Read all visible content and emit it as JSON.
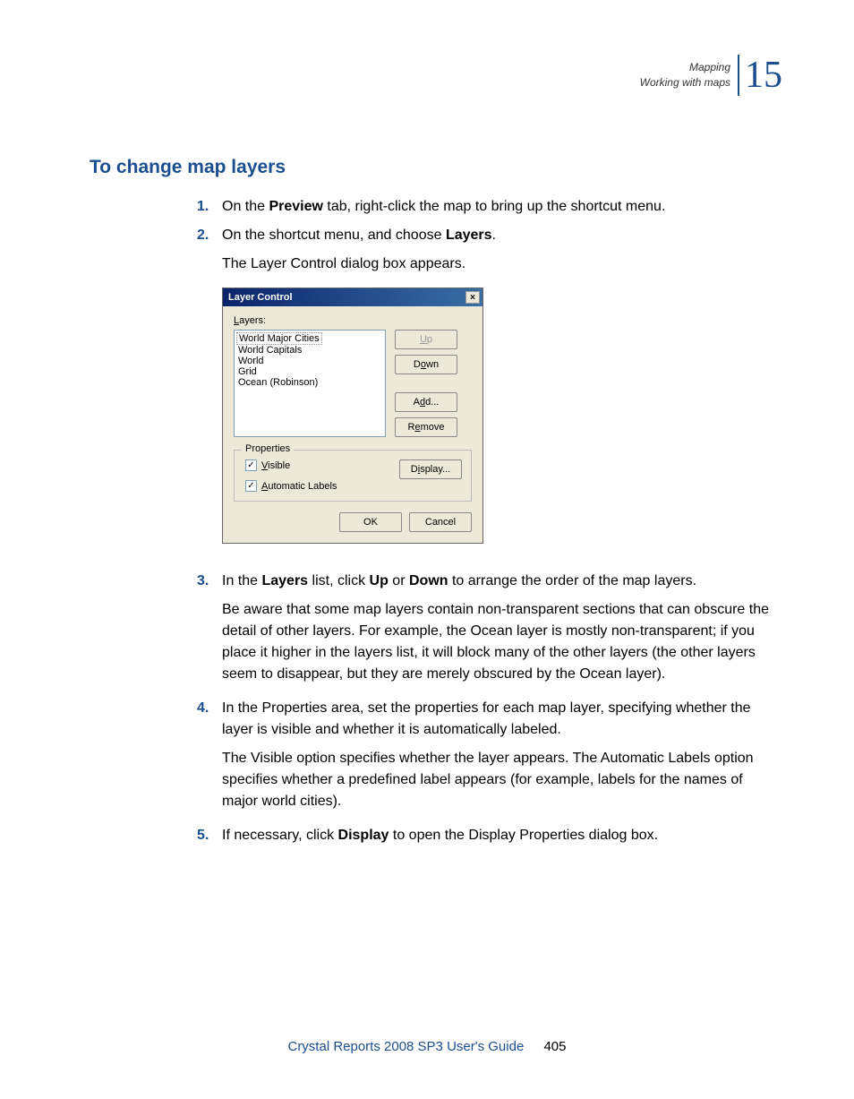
{
  "header": {
    "line1": "Mapping",
    "line2": "Working with maps",
    "chapter": "15"
  },
  "section_title": "To change map layers",
  "steps": {
    "s1": {
      "num": "1.",
      "prefix": "On the ",
      "bold": "Preview",
      "suffix": " tab, right-click the map to bring up the shortcut menu."
    },
    "s2": {
      "num": "2.",
      "prefix": "On the shortcut menu, and choose ",
      "bold": "Layers",
      "suffix": "."
    },
    "s2_para": "The Layer Control dialog box appears.",
    "s3": {
      "num": "3.",
      "prefix": "In the ",
      "bold1": "Layers",
      "mid1": " list, click ",
      "bold2": "Up",
      "mid2": " or ",
      "bold3": "Down",
      "suffix": " to arrange the order of the map layers."
    },
    "s3_para": "Be aware that some map layers contain non-transparent sections that can obscure the detail of other layers. For example, the Ocean layer is mostly non-transparent; if you place it higher in the layers list, it will block many of the other layers (the other layers seem to disappear, but they are merely obscured by the Ocean layer).",
    "s4": {
      "num": "4.",
      "text": "In the Properties area, set the properties for each map layer, specifying whether the layer is visible and whether it is automatically labeled."
    },
    "s4_para": "The Visible option specifies whether the layer appears. The Automatic Labels option specifies whether a predefined label appears (for example, labels for the names of major world cities).",
    "s5": {
      "num": "5.",
      "prefix": "If necessary, click ",
      "bold": "Display",
      "suffix": " to open the Display Properties dialog box."
    }
  },
  "dialog": {
    "title": "Layer Control",
    "close_glyph": "×",
    "layers_label_pre": "L",
    "layers_label_post": "ayers:",
    "items": {
      "i0": "World Major Cities",
      "i1": "World Capitals",
      "i2": "World",
      "i3": "Grid",
      "i4": "Ocean (Robinson)"
    },
    "buttons": {
      "up_pre": "U",
      "up_post": "p",
      "down_pre": "D",
      "down_mid": "o",
      "down_post": "wn",
      "add_pre": "A",
      "add_mid": "d",
      "add_post": "d...",
      "remove_pre": "R",
      "remove_mid": "e",
      "remove_post": "move",
      "display_pre": "D",
      "display_mid": "i",
      "display_post": "splay...",
      "ok": "OK",
      "cancel": "Cancel"
    },
    "properties": {
      "legend": "Properties",
      "visible_pre": "V",
      "visible_post": "isible",
      "autolabels_pre": "A",
      "autolabels_post": "utomatic Labels",
      "check_glyph": "✓"
    }
  },
  "footer": {
    "guide": "Crystal Reports 2008 SP3 User's Guide",
    "page": "405"
  }
}
